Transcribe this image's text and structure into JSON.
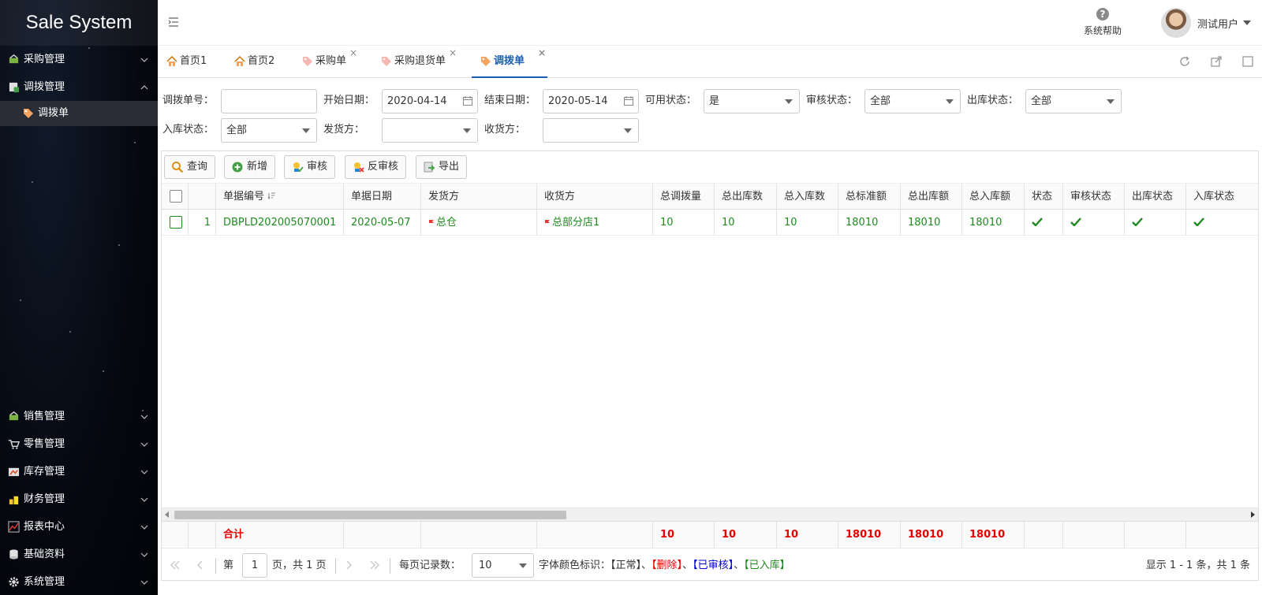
{
  "app": {
    "title": "Sale System"
  },
  "sidebar": {
    "menu_top": [
      {
        "label": "采购管理",
        "expanded": false
      },
      {
        "label": "调拨管理",
        "expanded": true
      }
    ],
    "sub_items": [
      {
        "label": "调拨单"
      }
    ],
    "menu_bottom": [
      {
        "label": "销售管理"
      },
      {
        "label": "零售管理"
      },
      {
        "label": "库存管理"
      },
      {
        "label": "财务管理"
      },
      {
        "label": "报表中心"
      },
      {
        "label": "基础资料"
      },
      {
        "label": "系统管理"
      }
    ]
  },
  "header": {
    "help_label": "系统帮助",
    "help_glyph": "?",
    "user_name": "测试用户"
  },
  "tabs": [
    {
      "label": "首页1",
      "closable": false,
      "active": false
    },
    {
      "label": "首页2",
      "closable": false,
      "active": false
    },
    {
      "label": "采购单",
      "closable": true,
      "active": false
    },
    {
      "label": "采购退货单",
      "closable": true,
      "active": false
    },
    {
      "label": "调拨单",
      "closable": true,
      "active": true
    }
  ],
  "tab_close_glyph": "×",
  "filters": {
    "order_no_label": "调拨单号：",
    "order_no_value": "",
    "start_date_label": "开始日期：",
    "start_date_value": "2020-04-14",
    "end_date_label": "结束日期：",
    "end_date_value": "2020-05-14",
    "available_label": "可用状态：",
    "available_value": "是",
    "audit_label": "审核状态：",
    "audit_value": "全部",
    "outbound_label": "出库状态：",
    "outbound_value": "全部",
    "inbound_label": "入库状态：",
    "inbound_value": "全部",
    "sender_label": "发货方：",
    "sender_value": "",
    "receiver_label": "收货方：",
    "receiver_value": ""
  },
  "toolbar": {
    "query": "查询",
    "add": "新增",
    "audit": "审核",
    "unaudit": "反审核",
    "export": "导出"
  },
  "table": {
    "headers": {
      "order_no": "单据编号",
      "date": "单据日期",
      "sender": "发货方",
      "receiver": "收货方",
      "total_qty": "总调拨量",
      "total_out": "总出库数",
      "total_in": "总入库数",
      "total_std": "总标准额",
      "total_out_amt": "总出库额",
      "total_in_amt": "总入库额",
      "status": "状态",
      "audit_status": "审核状态",
      "out_status": "出库状态",
      "in_status": "入库状态"
    },
    "rows": [
      {
        "index": "1",
        "order_no": "DBPLD202005070001",
        "date": "2020-05-07",
        "sender": "总仓",
        "receiver": "总部分店1",
        "total_qty": "10",
        "total_out": "10",
        "total_in": "10",
        "total_std": "18010",
        "total_out_amt": "18010",
        "total_in_amt": "18010",
        "status": true,
        "audit_status": true,
        "out_status": true,
        "in_status": true
      }
    ],
    "footer": {
      "label": "合计",
      "total_qty": "10",
      "total_out": "10",
      "total_in": "10",
      "total_std": "18010",
      "total_out_amt": "18010",
      "total_in_amt": "18010"
    }
  },
  "pager": {
    "page_prefix": "第",
    "page_value": "1",
    "page_suffix": "页，共 1 页",
    "page_size_label": "每页记录数：",
    "page_size_value": "10",
    "legend_label": "字体颜色标识：",
    "legend_normal": "【正常】",
    "legend_sep1": "、",
    "legend_deleted": "【删除】",
    "legend_sep2": "、",
    "legend_audited": "【已审核】",
    "legend_sep3": "、",
    "legend_inbound": "【已入库】",
    "summary": "显示 1 - 1 条，共 1 条"
  },
  "colors": {
    "accent": "#1a5fb4",
    "row_text": "#1e8a1e",
    "total_text": "#e60000",
    "deleted": "#e60000",
    "audited": "#0000dd",
    "inbound": "#1e8a1e"
  }
}
